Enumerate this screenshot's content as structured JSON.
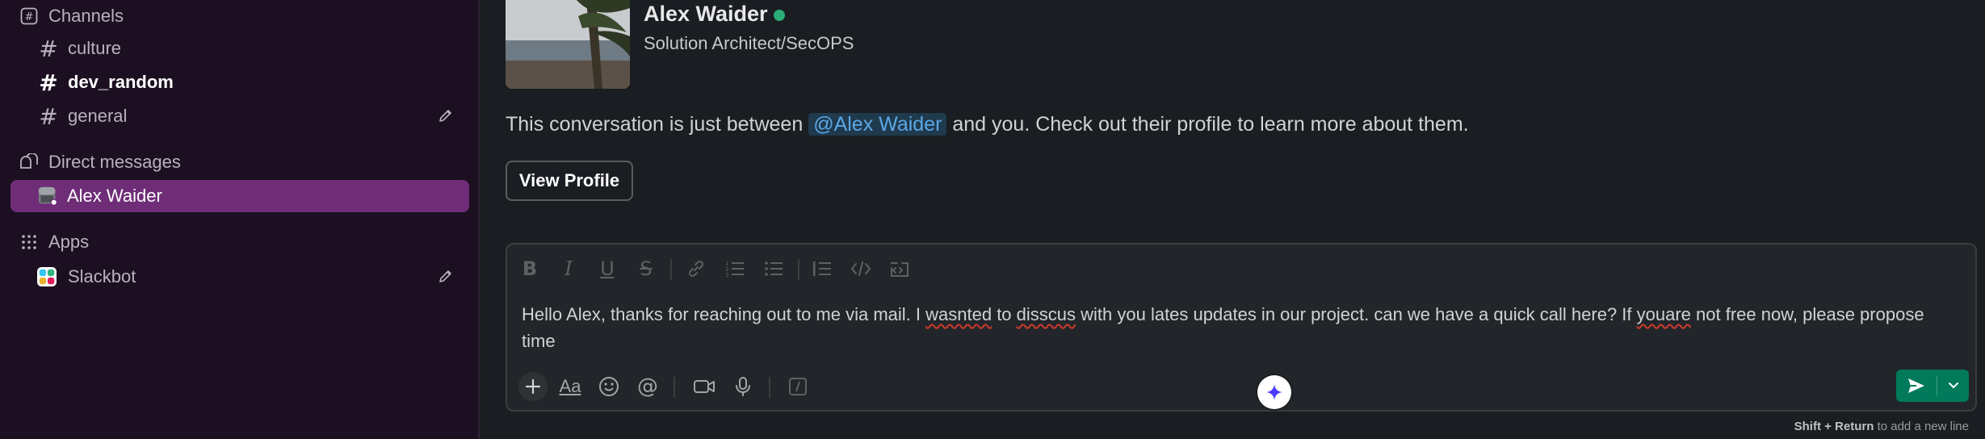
{
  "sidebar": {
    "channels_header": "Channels",
    "channels": [
      {
        "name": "culture"
      },
      {
        "name": "dev_random"
      },
      {
        "name": "general"
      }
    ],
    "dm_header": "Direct messages",
    "dms": [
      {
        "name": "Alex Waider"
      }
    ],
    "apps_header": "Apps",
    "apps": [
      {
        "name": "Slackbot"
      }
    ]
  },
  "profile": {
    "name": "Alex Waider",
    "title": "Solution Architect/SecOPS",
    "status_color": "#2bac76"
  },
  "intro": {
    "before": "This conversation is just between ",
    "mention": "@Alex Waider",
    "after": " and you. Check out their profile to learn more about them."
  },
  "view_profile_label": "View Profile",
  "composer": {
    "text_segments": [
      {
        "t": "Hello Alex, thanks for reaching out to me via mail. I "
      },
      {
        "t": "wasnted",
        "err": true
      },
      {
        "t": " to "
      },
      {
        "t": "disscus",
        "err": true
      },
      {
        "t": " with you lates updates in our project. can we have a quick call here? If "
      },
      {
        "t": "youare",
        "err": true
      },
      {
        "t": " not free now, please propose time"
      }
    ],
    "hint_bold": "Shift + Return",
    "hint_rest": " to add a new line"
  },
  "colors": {
    "sidebar_bg": "#1c0f21",
    "active_item": "#6f2d78",
    "send_button": "#007a5a",
    "mention": "#5ba7e5"
  }
}
